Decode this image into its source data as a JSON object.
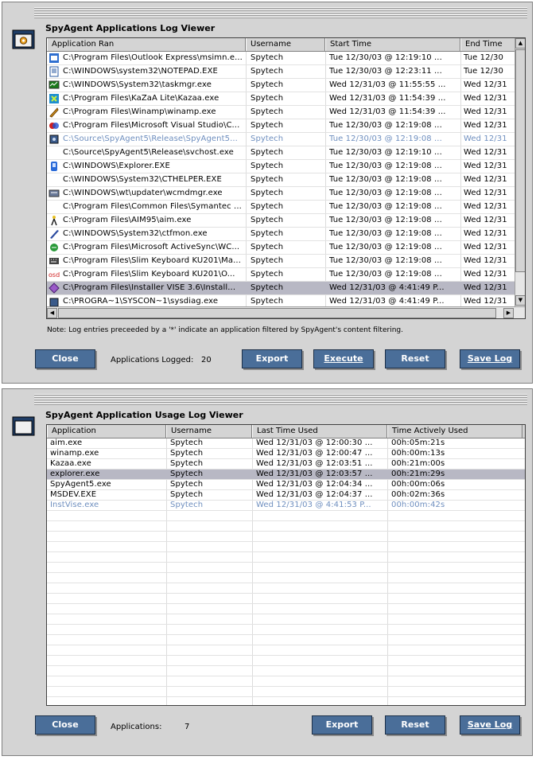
{
  "app_log": {
    "title": "SpyAgent Applications Log Viewer",
    "columns": [
      "Application Ran",
      "Username",
      "Start Time",
      "End Time"
    ],
    "rows": [
      {
        "icon": "outlook-express-icon",
        "app": "C:\\Program Files\\Outlook Express\\msimn.e...",
        "user": "Spytech",
        "start": "Tue  12/30/03 @ 12:19:10 ...",
        "end": "Tue  12/30",
        "state": "normal"
      },
      {
        "icon": "notepad-icon",
        "app": "C:\\WINDOWS\\system32\\NOTEPAD.EXE",
        "user": "Spytech",
        "start": "Tue  12/30/03 @ 12:23:11 ...",
        "end": "Tue  12/30",
        "state": "normal"
      },
      {
        "icon": "task-manager-icon",
        "app": "C:\\WINDOWS\\System32\\taskmgr.exe",
        "user": "Spytech",
        "start": "Wed  12/31/03 @ 11:55:55 ...",
        "end": "Wed  12/31",
        "state": "normal"
      },
      {
        "icon": "kazaa-icon",
        "app": "C:\\Program Files\\KaZaA Lite\\Kazaa.exe",
        "user": "Spytech",
        "start": "Wed  12/31/03 @ 11:54:39 ...",
        "end": "Wed  12/31",
        "state": "normal"
      },
      {
        "icon": "winamp-icon",
        "app": "C:\\Program Files\\Winamp\\winamp.exe",
        "user": "Spytech",
        "start": "Wed  12/31/03 @ 11:54:39 ...",
        "end": "Wed  12/31",
        "state": "normal"
      },
      {
        "icon": "visual-studio-icon",
        "app": "C:\\Program Files\\Microsoft Visual Studio\\C...",
        "user": "Spytech",
        "start": "Tue  12/30/03 @ 12:19:08 ...",
        "end": "Wed  12/31",
        "state": "normal"
      },
      {
        "icon": "spyagent-icon",
        "app": "C:\\Source\\SpyAgent5\\Release\\SpyAgent5...",
        "user": "Spytech",
        "start": "Tue  12/30/03 @ 12:19:08 ...",
        "end": "Wed  12/31",
        "state": "filtered"
      },
      {
        "icon": "",
        "app": "C:\\Source\\SpyAgent5\\Release\\svchost.exe",
        "user": "Spytech",
        "start": "Tue  12/30/03 @ 12:19:10 ...",
        "end": "Wed  12/31",
        "state": "normal"
      },
      {
        "icon": "explorer-icon",
        "app": "C:\\WINDOWS\\Explorer.EXE",
        "user": "Spytech",
        "start": "Tue  12/30/03 @ 12:19:08 ...",
        "end": "Wed  12/31",
        "state": "normal"
      },
      {
        "icon": "",
        "app": "C:\\WINDOWS\\System32\\CTHELPER.EXE",
        "user": "Spytech",
        "start": "Tue  12/30/03 @ 12:19:08 ...",
        "end": "Wed  12/31",
        "state": "normal"
      },
      {
        "icon": "updater-icon",
        "app": "C:\\WINDOWS\\wt\\updater\\wcmdmgr.exe",
        "user": "Spytech",
        "start": "Tue  12/30/03 @ 12:19:08 ...",
        "end": "Wed  12/31",
        "state": "normal"
      },
      {
        "icon": "",
        "app": "C:\\Program Files\\Common Files\\Symantec ...",
        "user": "Spytech",
        "start": "Tue  12/30/03 @ 12:19:08 ...",
        "end": "Wed  12/31",
        "state": "normal"
      },
      {
        "icon": "aim-icon",
        "app": "C:\\Program Files\\AIM95\\aim.exe",
        "user": "Spytech",
        "start": "Tue  12/30/03 @ 12:19:08 ...",
        "end": "Wed  12/31",
        "state": "normal"
      },
      {
        "icon": "ctfmon-icon",
        "app": "C:\\WINDOWS\\System32\\ctfmon.exe",
        "user": "Spytech",
        "start": "Tue  12/30/03 @ 12:19:08 ...",
        "end": "Wed  12/31",
        "state": "normal"
      },
      {
        "icon": "activesync-icon",
        "app": "C:\\Program Files\\Microsoft ActiveSync\\WC...",
        "user": "Spytech",
        "start": "Tue  12/30/03 @ 12:19:08 ...",
        "end": "Wed  12/31",
        "state": "normal"
      },
      {
        "icon": "keyboard-icon",
        "app": "C:\\Program Files\\Slim Keyboard KU201\\Ma...",
        "user": "Spytech",
        "start": "Tue  12/30/03 @ 12:19:08 ...",
        "end": "Wed  12/31",
        "state": "normal"
      },
      {
        "icon": "osd-icon",
        "app": "C:\\Program Files\\Slim Keyboard KU201\\O...",
        "user": "Spytech",
        "start": "Tue  12/30/03 @ 12:19:08 ...",
        "end": "Wed  12/31",
        "state": "normal"
      },
      {
        "icon": "installer-vise-icon",
        "app": "C:\\Program Files\\Installer VISE 3.6\\Install...",
        "user": "Spytech",
        "start": "Wed  12/31/03 @ 4:41:49 P...",
        "end": "Wed  12/31",
        "state": "selected"
      },
      {
        "icon": "sysdiag-icon",
        "app": "C:\\PROGRA~1\\SYSCON~1\\sysdiag.exe",
        "user": "Spytech",
        "start": "Wed  12/31/03 @ 4:41:49 P...",
        "end": "Wed  12/31",
        "state": "normal"
      }
    ],
    "note": "Note: Log entries preceeded by a '*' indicate an application filtered by SpyAgent's content filtering.",
    "buttons": {
      "close": "Close",
      "export": "Export",
      "execute": "Execute",
      "reset": "Reset",
      "save_log": "Save Log"
    },
    "count_label": "Applications Logged:",
    "count_value": "20"
  },
  "usage_log": {
    "title": "SpyAgent Application Usage Log Viewer",
    "columns": [
      "Application",
      "Username",
      "Last Time Used",
      "Time Actively Used"
    ],
    "rows": [
      {
        "app": "aim.exe",
        "user": "Spytech",
        "last": "Wed  12/31/03 @ 12:00:30 ...",
        "active": "00h:05m:21s",
        "state": "normal"
      },
      {
        "app": "winamp.exe",
        "user": "Spytech",
        "last": "Wed  12/31/03 @ 12:00:47 ...",
        "active": "00h:00m:13s",
        "state": "normal"
      },
      {
        "app": "Kazaa.exe",
        "user": "Spytech",
        "last": "Wed  12/31/03 @ 12:03:51 ...",
        "active": "00h:21m:00s",
        "state": "normal"
      },
      {
        "app": "explorer.exe",
        "user": "Spytech",
        "last": "Wed  12/31/03 @ 12:03:57 ...",
        "active": "00h:21m:29s",
        "state": "selected"
      },
      {
        "app": "SpyAgent5.exe",
        "user": "Spytech",
        "last": "Wed  12/31/03 @ 12:04:34 ...",
        "active": "00h:00m:06s",
        "state": "normal"
      },
      {
        "app": "MSDEV.EXE",
        "user": "Spytech",
        "last": "Wed  12/31/03 @ 12:04:37 ...",
        "active": "00h:02m:36s",
        "state": "normal"
      },
      {
        "app": "InstVise.exe",
        "user": "Spytech",
        "last": "Wed  12/31/03 @ 4:41:53 P...",
        "active": "00h:00m:42s",
        "state": "filtered"
      }
    ],
    "buttons": {
      "close": "Close",
      "export": "Export",
      "reset": "Reset",
      "save_log": "Save Log"
    },
    "count_label": "Applications:",
    "count_value": "7"
  }
}
